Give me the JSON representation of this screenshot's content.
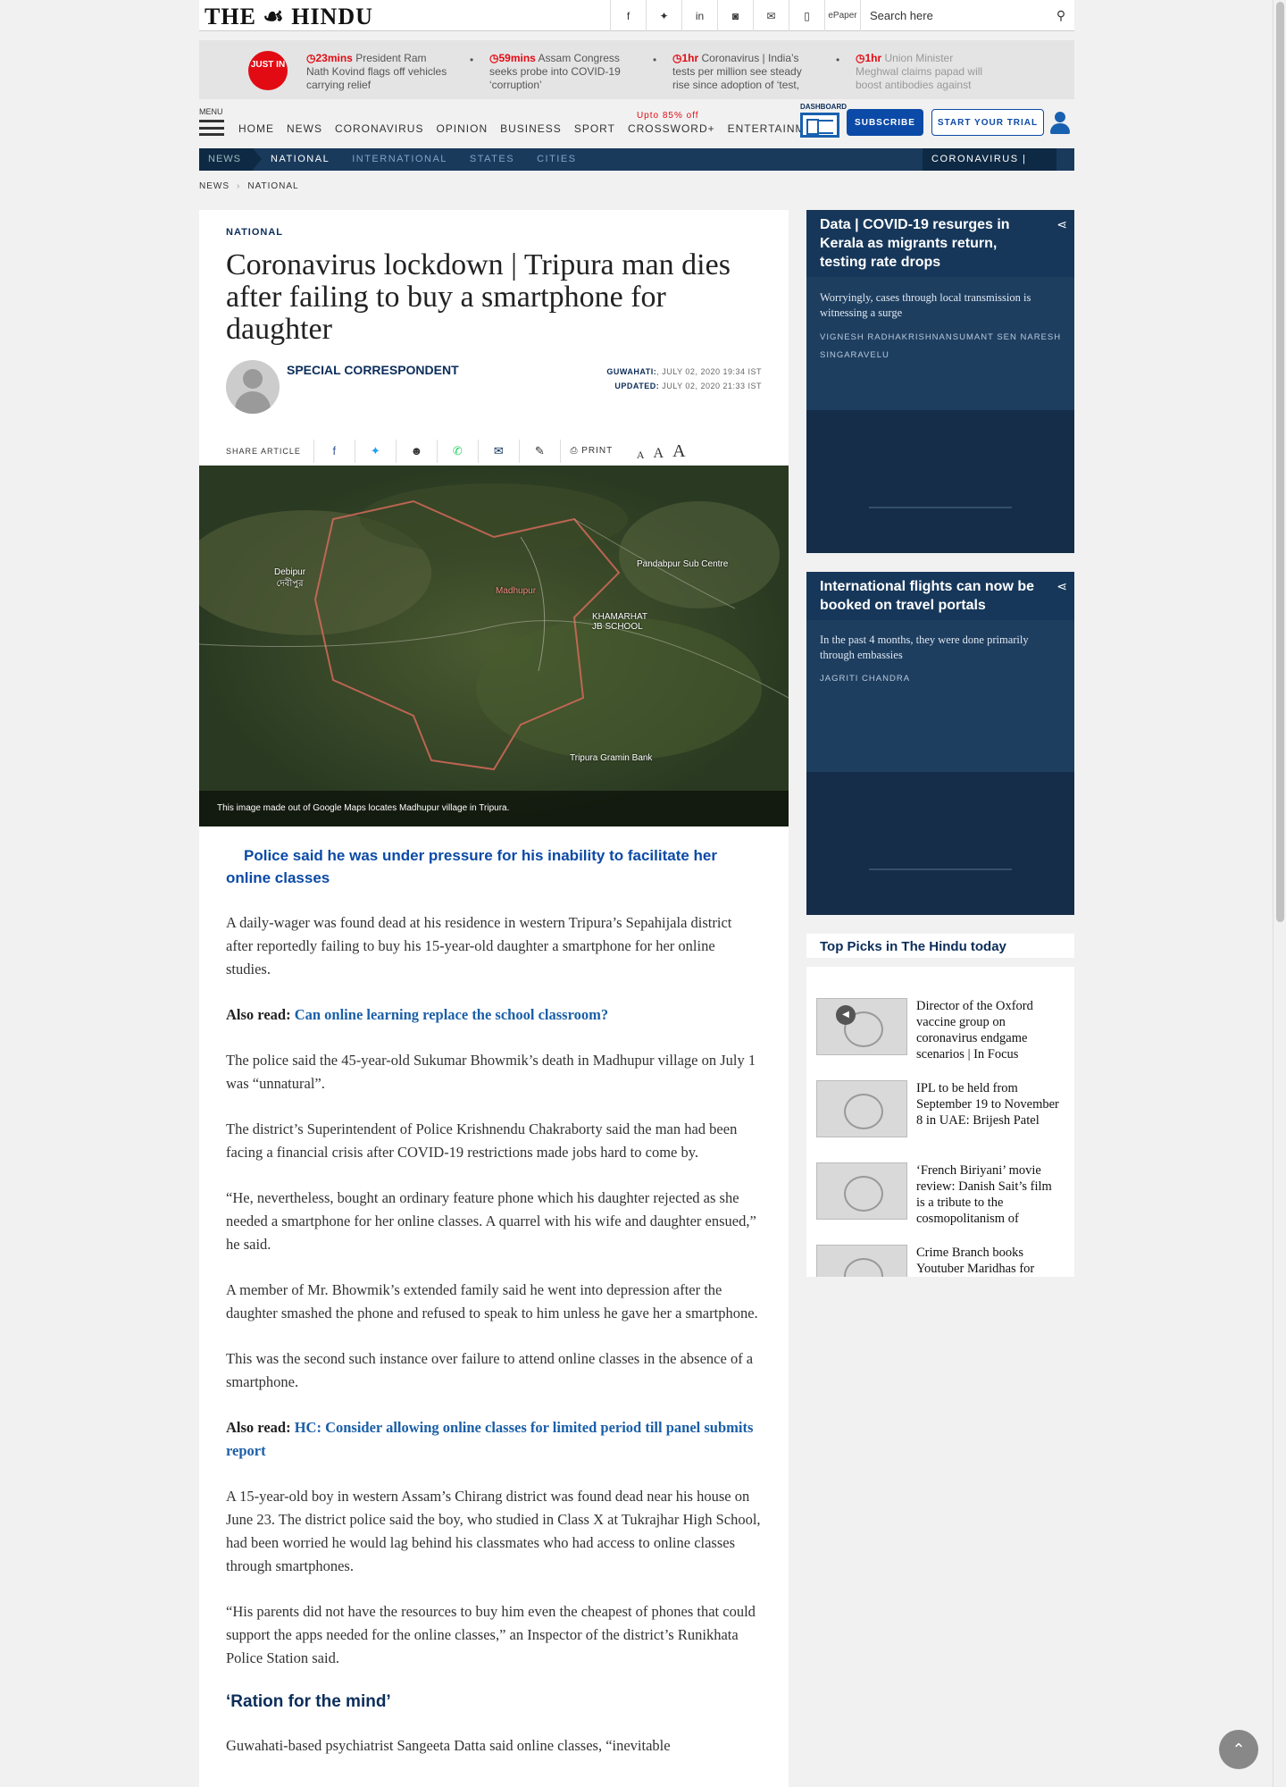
{
  "site": {
    "logo": "THE ☙ HINDU",
    "epaper": "ePaper",
    "search_placeholder": "Search here"
  },
  "social_icons": [
    "facebook-icon",
    "twitter-icon",
    "linkedin-icon",
    "instagram-icon",
    "mail-icon",
    "mobile-icon"
  ],
  "just_in": {
    "badge": "JUST IN",
    "items": [
      {
        "time": "23mins",
        "text": "President Ram Nath Kovind flags off vehicles carrying relief"
      },
      {
        "time": "59mins",
        "text": "Assam Congress seeks probe into COVID-19 ‘corruption’"
      },
      {
        "time": "1hr",
        "text": "Coronavirus | India’s tests per million see steady rise since adoption of ‘test,"
      },
      {
        "time": "1hr",
        "text": "Union Minister Meghwal claims papad will boost antibodies against"
      }
    ]
  },
  "nav": {
    "menu": "MENU",
    "links": [
      "HOME",
      "NEWS",
      "CORONAVIRUS",
      "OPINION",
      "BUSINESS",
      "SPORT",
      "CROSSWORD+",
      "ENTERTAINMENT"
    ],
    "crossword_offer": "Upto 85% off",
    "dashboard": "DASHBOARD",
    "subscribe": "SUBSCRIBE",
    "trial": "START YOUR TRIAL"
  },
  "section_bar": {
    "root": "NEWS",
    "links": [
      "NATIONAL",
      "INTERNATIONAL",
      "STATES",
      "CITIES"
    ],
    "active": "NATIONAL",
    "right": "CORONAVIRUS |"
  },
  "breadcrumb": [
    "NEWS",
    "NATIONAL"
  ],
  "article": {
    "section": "NATIONAL",
    "headline": "Coronavirus lockdown | Tripura man dies after failing to buy a smartphone for daughter",
    "author": "SPECIAL CORRESPONDENT",
    "dateline_place": "GUWAHATI:",
    "dateline": ", JULY 02, 2020 19:34 IST",
    "updated_label": "UPDATED:",
    "updated": " JULY 02, 2020 21:33 IST",
    "share_label": "SHARE ARTICLE",
    "print": "PRINT",
    "font_sizes": [
      "A",
      "A",
      "A"
    ],
    "map_labels": [
      "Debipur\nদেবীপুর",
      "Madhupur",
      "KHAMARHAT\nJB SCHOOL",
      "Pandabpur Sub Centre",
      "Tripura Gramin Bank"
    ],
    "image_caption": "This image made out of Google Maps locates Madhupur village in Tripura.",
    "summary": "Police said he was under pressure for his inability to facilitate her online classes",
    "p1": "A daily-wager was found dead at his residence in western Tripura’s Sepahijala district after reportedly failing to buy his 15-year-old daughter a smartphone for her online studies.",
    "also_read_label": "Also read:",
    "also_read_1": "Can online learning replace the school classroom?",
    "p2": "The police said the 45-year-old Sukumar Bhowmik’s death in Madhupur village on July 1 was “unnatural”.",
    "p3": "The district’s Superintendent of Police Krishnendu Chakraborty said the man had been facing a financial crisis after COVID-19 restrictions made jobs hard to come by.",
    "p4": "“He, nevertheless, bought an ordinary feature phone which his daughter rejected as she needed a smartphone for her online classes. A quarrel with his wife and daughter ensued,” he said.",
    "p5": "A member of Mr. Bhowmik’s extended family said he went into depression after the daughter smashed the phone and refused to speak to him unless he gave her a smartphone.",
    "p6": "This was the second such instance over failure to attend online classes in the absence of a smartphone.",
    "also_read_2": "HC: Consider allowing online classes for limited period till panel submits report",
    "p7": "A 15-year-old boy in western Assam’s Chirang district was found dead near his house on June 23. The district police said the boy, who studied in Class X at Tukrajhar High School, had been worried he would lag behind his classmates who had access to online classes through smartphones.",
    "p8": "“His parents did not have the resources to buy him even the cheapest of phones that could support the apps needed for the online classes,” an Inspector of the district’s Runikhata Police Station said.",
    "subhead": "‘Ration for the mind’",
    "p9": "Guwahati-based psychiatrist Sangeeta Datta said online classes, “inevitable"
  },
  "sidebar": {
    "card1": {
      "title": "Data | COVID-19 resurges in Kerala as migrants return, testing rate drops",
      "desc": "Worryingly, cases through local transmission is witnessing a surge",
      "authors": "VIGNESH RADHAKRISHNANSUMANT SEN NARESH SINGARAVELU"
    },
    "card2": {
      "title": "International flights can now be booked on travel portals",
      "desc": "In the past 4 months, they were done primarily through embassies",
      "authors": "JAGRITI CHANDRA"
    },
    "top_picks_title": "Top Picks in The Hindu today",
    "top_picks": [
      "Director of the Oxford vaccine group on coronavirus endgame scenarios | In Focus",
      "IPL to be held from September 19 to November 8 in UAE: Brijesh Patel",
      "‘French Biriyani’ movie review: Danish Sait’s film is a tribute to the cosmopolitanism of",
      "Crime Branch books Youtuber Maridhas for"
    ]
  }
}
